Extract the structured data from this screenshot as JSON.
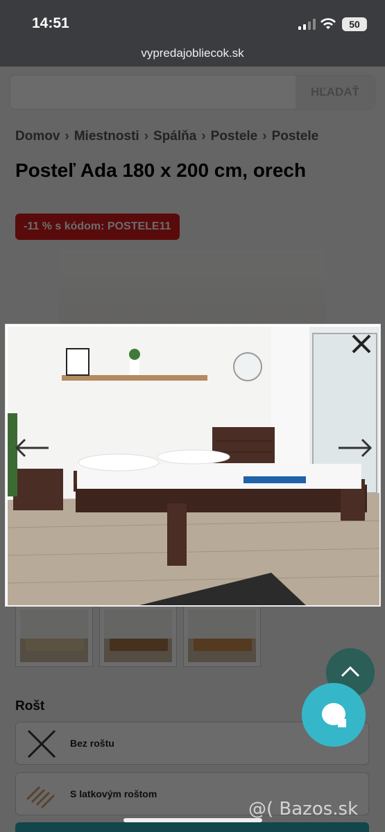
{
  "status_bar": {
    "time": "14:51",
    "battery": "50"
  },
  "browser": {
    "url": "vypredajobliecok.sk"
  },
  "search": {
    "placeholder": "",
    "button_label": "HĽADAŤ"
  },
  "breadcrumb": [
    "Domov",
    "Miestnosti",
    "Spálňa",
    "Postele",
    "Postele"
  ],
  "product": {
    "title": "Posteľ Ada 180 x 200 cm, orech",
    "promo_badge": "-11 % s kódom: POSTELE11"
  },
  "section_rost": {
    "heading": "Rošt",
    "options": [
      {
        "label": "Bez roštu",
        "icon": "no-slats-x-icon"
      },
      {
        "label": "S latkovým roštom",
        "icon": "slat-frame-icon"
      }
    ]
  },
  "lightbox": {
    "close_icon": "close-icon",
    "prev_icon": "arrow-left-icon",
    "next_icon": "arrow-right-icon"
  },
  "watermark": "@( Bazos.sk",
  "colors": {
    "promo_red": "#d41c1c",
    "chat_teal": "#35b7c9",
    "scroll_up_green": "#2a5e57",
    "status_bar": "#3a3c3f"
  }
}
